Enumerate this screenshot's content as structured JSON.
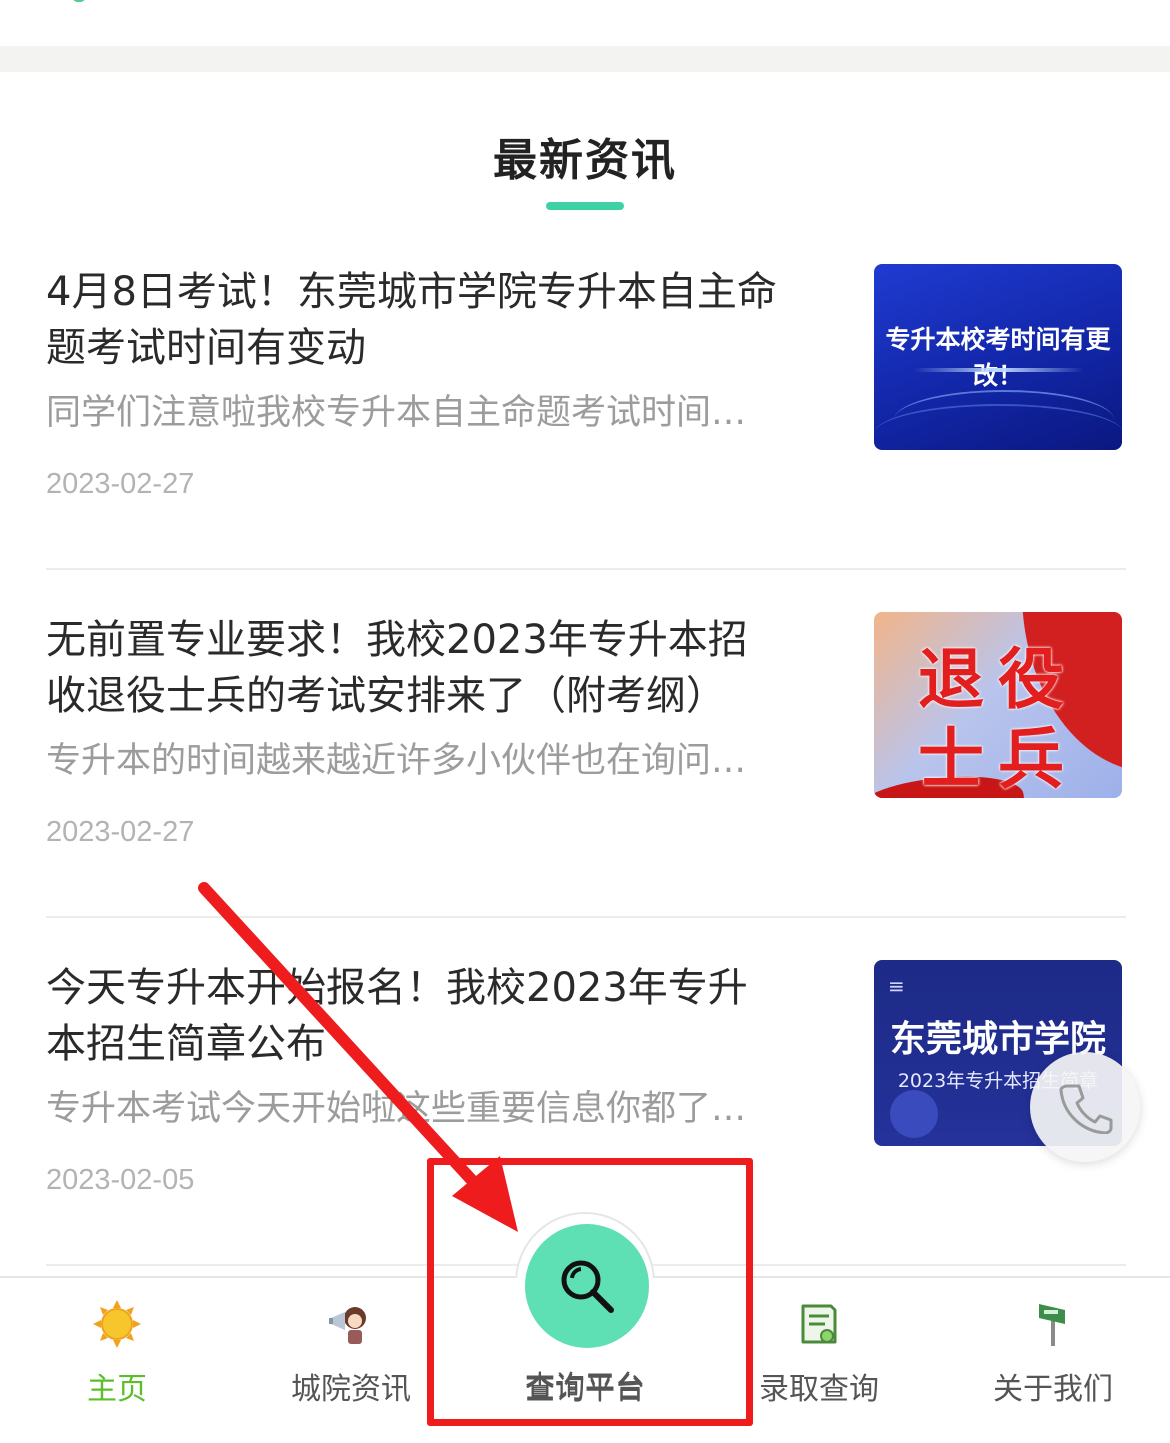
{
  "section": {
    "title": "最新资讯"
  },
  "news": [
    {
      "title": "4月8日考试！东莞城市学院专升本自主命题考试时间有变动",
      "summary": "同学们注意啦我校专升本自主命题考试时间…",
      "date": "2023-02-27",
      "thumbnail_text": "专升本校考时间有更改！"
    },
    {
      "title": "无前置专业要求！我校2023年专升本招收退役士兵的考试安排来了（附考纲）",
      "summary": "专升本的时间越来越近许多小伙伴也在询问…",
      "date": "2023-02-27",
      "thumbnail_text_line1": "退役",
      "thumbnail_text_line2": "士兵"
    },
    {
      "title": "今天专升本开始报名！我校2023年专升本招生简章公布",
      "summary": "专升本考试今天开始啦这些重要信息你都了…",
      "date": "2023-02-05",
      "thumbnail_text": "东莞城市学院",
      "thumbnail_subtext": "2023年专升本招生简章"
    }
  ],
  "bottom_nav": {
    "items": [
      {
        "label": "主页",
        "icon": "sun-icon",
        "active": true
      },
      {
        "label": "城院资讯",
        "icon": "megaphone-girl-icon",
        "active": false
      },
      {
        "label": "查询平台",
        "icon": "search-icon",
        "active": false
      },
      {
        "label": "录取查询",
        "icon": "certificate-icon",
        "active": false
      },
      {
        "label": "关于我们",
        "icon": "signpost-icon",
        "active": false
      }
    ]
  },
  "floating": {
    "icon": "phone-icon"
  },
  "colors": {
    "accent": "#3fd0a4",
    "active_nav": "#5cbf2a",
    "search_fab": "#5ee0b4",
    "annotation_red": "#ee1c1c"
  }
}
